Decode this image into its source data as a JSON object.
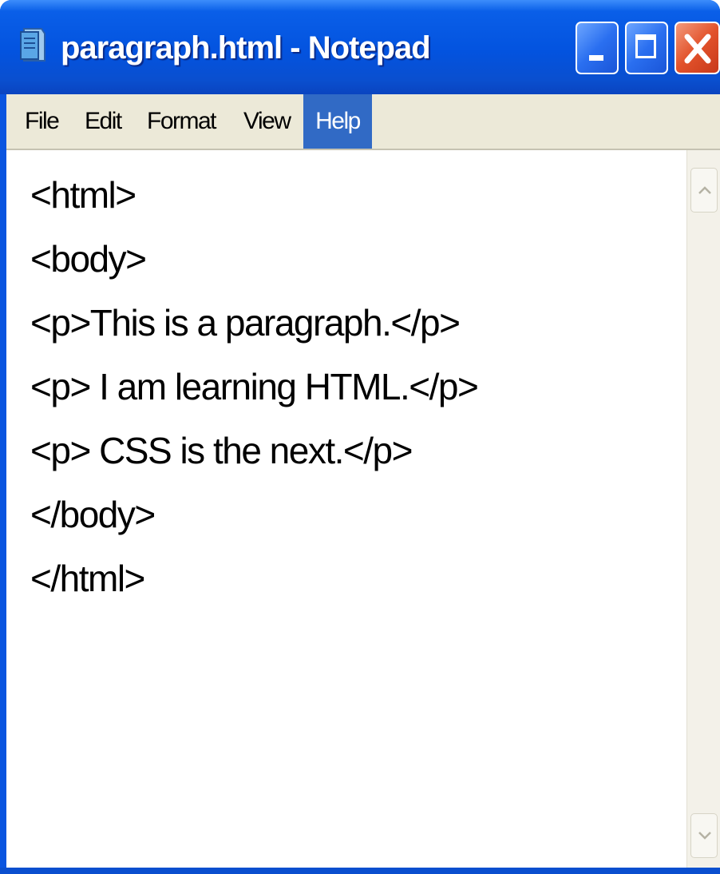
{
  "window": {
    "title": "paragraph.html - Notepad",
    "app_icon": "notepad-icon",
    "controls": [
      "minimize-icon",
      "maximize-icon",
      "close-icon"
    ]
  },
  "menu": {
    "items": [
      "File",
      "Edit",
      "Format",
      "View",
      "Help"
    ],
    "selected": "Help"
  },
  "editor": {
    "lines": [
      "<html>",
      "<body>",
      "<p>This is a paragraph.</p>",
      "<p> I am learning HTML.</p>",
      "<p> CSS is the next.</p>",
      "</body>",
      "</html>"
    ]
  },
  "colors": {
    "titlebar": "#0353df",
    "menubar": "#ece9d8",
    "menu_highlight": "#316ac5",
    "close_button": "#e2522b"
  }
}
